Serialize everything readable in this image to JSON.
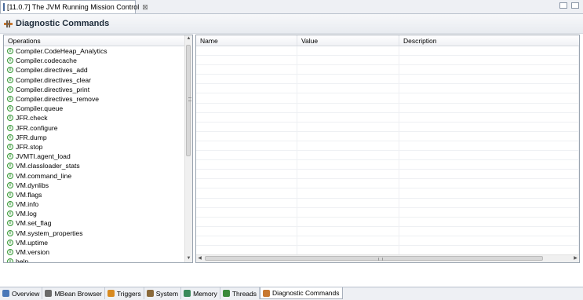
{
  "editor_tab": {
    "title": "[11.0.7] The JVM Running Mission Control",
    "close": "⊠",
    "icon": "jvm-app-icon"
  },
  "header": {
    "title": "Diagnostic Commands",
    "icon": "diagnostic-commands-icon"
  },
  "operations": {
    "header": "Operations",
    "items": [
      "Compiler.CodeHeap_Analytics",
      "Compiler.codecache",
      "Compiler.directives_add",
      "Compiler.directives_clear",
      "Compiler.directives_print",
      "Compiler.directives_remove",
      "Compiler.queue",
      "JFR.check",
      "JFR.configure",
      "JFR.dump",
      "JFR.stop",
      "JVMTI.agent_load",
      "VM.classloader_stats",
      "VM.command_line",
      "VM.dynlibs",
      "VM.flags",
      "VM.info",
      "VM.log",
      "VM.set_flag",
      "VM.system_properties",
      "VM.uptime",
      "VM.version",
      "help"
    ]
  },
  "details_table": {
    "columns": [
      "Name",
      "Value",
      "Description"
    ]
  },
  "bottom_tabs": [
    {
      "label": "Overview",
      "icon": "overview-icon",
      "color": "#4a78b8"
    },
    {
      "label": "MBean Browser",
      "icon": "mbean-browser-icon",
      "color": "#6a6a6a"
    },
    {
      "label": "Triggers",
      "icon": "triggers-icon",
      "color": "#d88a20"
    },
    {
      "label": "System",
      "icon": "system-icon",
      "color": "#8a6a3a"
    },
    {
      "label": "Memory",
      "icon": "memory-icon",
      "color": "#3a8a5a"
    },
    {
      "label": "Threads",
      "icon": "threads-icon",
      "color": "#3a8a3a"
    },
    {
      "label": "Diagnostic Commands",
      "icon": "diagnostic-commands-icon",
      "color": "#c87830"
    }
  ],
  "active_bottom_tab": "Diagnostic Commands"
}
